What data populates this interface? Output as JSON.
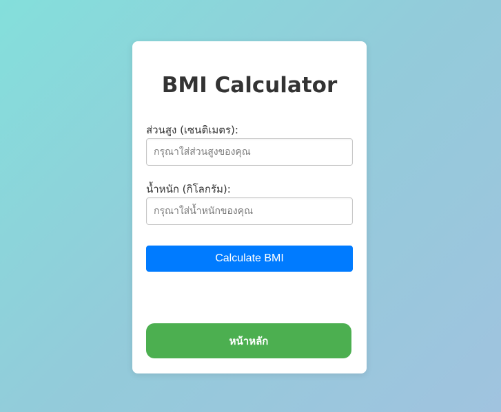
{
  "page": {
    "title": "BMI Calculator"
  },
  "form": {
    "height": {
      "label": "ส่วนสูง (เซนติเมตร):",
      "value": "",
      "placeholder": "กรุณาใส่ส่วนสูงของคุณ"
    },
    "weight": {
      "label": "น้ำหนัก (กิโลกรัม):",
      "value": "",
      "placeholder": "กรุณาใส่น้ำหนักของคุณ"
    },
    "calculate_label": "Calculate BMI",
    "result_text": ""
  },
  "home_button_label": "หน้าหลัก",
  "colors": {
    "primary": "#007bff",
    "success": "#4caf50",
    "text": "#333333"
  }
}
